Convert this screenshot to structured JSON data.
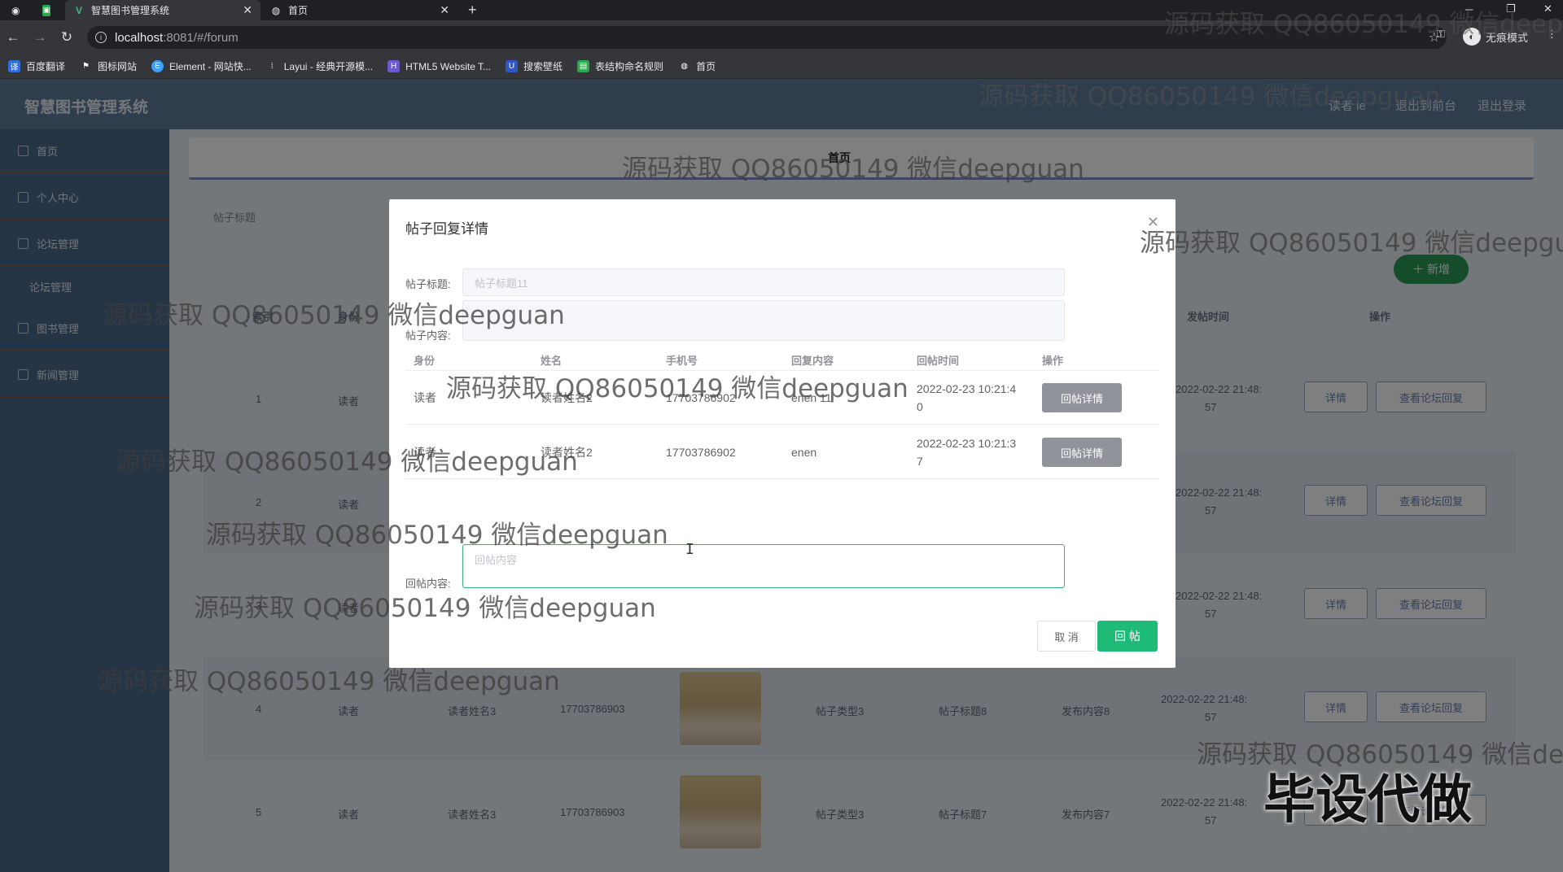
{
  "browser": {
    "tabs": [
      {
        "title": "智慧图书管理系统",
        "active": true
      },
      {
        "title": "首页",
        "active": false
      }
    ],
    "url_host": "localhost",
    "url_path": ":8081/#/forum",
    "incognito_label": "无痕模式",
    "bookmarks": [
      "百度翻译",
      "图标网站",
      "Element - 网站快...",
      "Layui - 经典开源模...",
      "HTML5 Website T...",
      "搜索壁纸",
      "表结构命名规则",
      "首页"
    ]
  },
  "app": {
    "title": "智慧图书管理系统",
    "header_links": [
      "读者 ie",
      "退出到前台",
      "退出登录"
    ],
    "sidebar": [
      "首页",
      "个人中心",
      "论坛管理",
      "论坛管理",
      "图书管理",
      "新闻管理"
    ],
    "breadcrumb": "首页",
    "search_label": "帖子标题",
    "add_button": "新增",
    "columns": [
      "索引",
      "身份",
      "发帖时间",
      "操作"
    ],
    "rows": [
      {
        "index": "1",
        "role": "读者",
        "name": "",
        "phone": "",
        "type": "",
        "title": "",
        "content": "",
        "time_a": "2022-02-22 21:48:",
        "time_b": "57"
      },
      {
        "index": "2",
        "role": "读者",
        "name": "",
        "phone": "",
        "type": "",
        "title": "",
        "content": "",
        "time_a": "2022-02-22 21:48:",
        "time_b": "57"
      },
      {
        "index": "3",
        "role": "读者",
        "name": "",
        "phone": "",
        "type": "",
        "title": "",
        "content": "",
        "time_a": "2022-02-22 21:48:",
        "time_b": "57"
      },
      {
        "index": "4",
        "role": "读者",
        "name": "读者姓名3",
        "phone": "17703786903",
        "type": "帖子类型3",
        "title": "帖子标题8",
        "content": "发布内容8",
        "time_a": "2022-02-22 21:48:",
        "time_b": "57"
      },
      {
        "index": "5",
        "role": "读者",
        "name": "读者姓名3",
        "phone": "17703786903",
        "type": "帖子类型3",
        "title": "帖子标题7",
        "content": "发布内容7",
        "time_a": "2022-02-22 21:48:",
        "time_b": "57"
      }
    ],
    "row_btn_detail": "详情",
    "row_btn_replies": "查看论坛回复"
  },
  "modal": {
    "title": "帖子回复详情",
    "label_title": "帖子标题:",
    "value_title": "帖子标题11",
    "label_content": "帖子内容:",
    "columns": [
      "身份",
      "姓名",
      "手机号",
      "回复内容",
      "回帖时间",
      "操作"
    ],
    "replies": [
      {
        "role": "读者",
        "name": "读者姓名2",
        "phone": "17703786902",
        "content": "enen 11",
        "time_a": "2022-02-23 10:21:4",
        "time_b": "0",
        "action": "回帖详情"
      },
      {
        "role": "读者",
        "name": "读者姓名2",
        "phone": "17703786902",
        "content": "enen",
        "time_a": "2022-02-23 10:21:3",
        "time_b": "7",
        "action": "回帖详情"
      }
    ],
    "reply_label": "回帖内容:",
    "reply_placeholder": "回帖内容",
    "cancel": "取 消",
    "submit": "回 帖"
  },
  "watermark": {
    "text": "源码获取 QQ86050149 微信deepguan",
    "big": "毕设代做"
  }
}
